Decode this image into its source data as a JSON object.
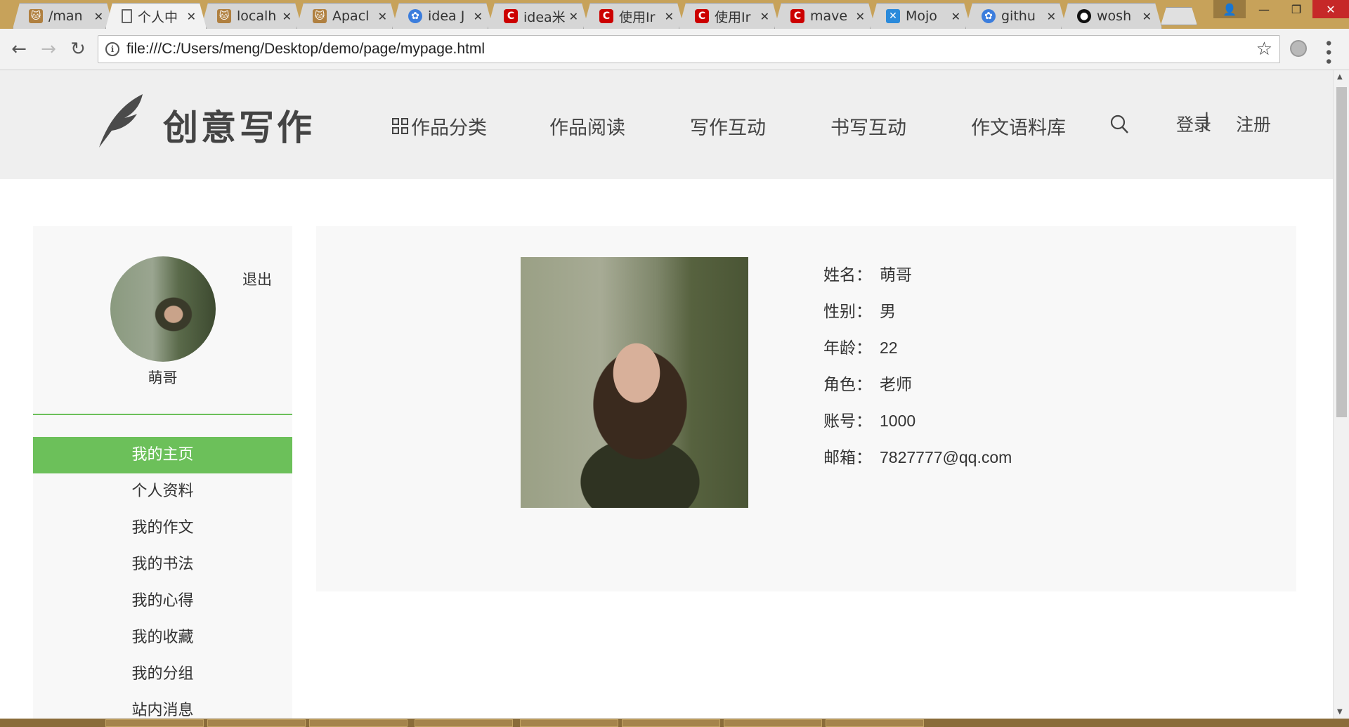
{
  "browser": {
    "tabs": [
      {
        "icon": "tomcat-icon",
        "title": "/man"
      },
      {
        "icon": "document-icon",
        "title": "个人中"
      },
      {
        "icon": "tomcat-icon",
        "title": "localh"
      },
      {
        "icon": "tomcat-icon",
        "title": "Apacl"
      },
      {
        "icon": "baidu-paw-icon",
        "title": "idea J"
      },
      {
        "icon": "csdn-icon",
        "title": "idea米"
      },
      {
        "icon": "csdn-icon",
        "title": "使用Ir"
      },
      {
        "icon": "csdn-icon",
        "title": "使用Ir"
      },
      {
        "icon": "csdn-icon",
        "title": "mave"
      },
      {
        "icon": "mojo-icon",
        "title": "Mojo"
      },
      {
        "icon": "baidu-paw-icon",
        "title": "githu"
      },
      {
        "icon": "github-icon",
        "title": "wosh"
      }
    ],
    "url": "file:///C:/Users/meng/Desktop/demo/page/mypage.html"
  },
  "site": {
    "logo_text": "创意写作",
    "nav": [
      "作品分类",
      "作品阅读",
      "写作互动",
      "书写互动",
      "作文语料库"
    ],
    "login": "登录",
    "separator": "|",
    "register": "注册"
  },
  "sidebar": {
    "logout": "退出",
    "username": "萌哥",
    "menu": [
      "我的主页",
      "个人资料",
      "我的作文",
      "我的书法",
      "我的心得",
      "我的收藏",
      "我的分组",
      "站内消息"
    ],
    "active_index": 0
  },
  "profile": {
    "rows": [
      {
        "key": "姓名：",
        "value": "萌哥"
      },
      {
        "key": "性别：",
        "value": "男"
      },
      {
        "key": "年龄：",
        "value": "22"
      },
      {
        "key": "角色：",
        "value": "老师"
      },
      {
        "key": "账号：",
        "value": "1000"
      },
      {
        "key": "邮箱：",
        "value": "7827777@qq.com"
      }
    ]
  },
  "colors": {
    "accent_green": "#6cc05a",
    "header_bg": "#efefef",
    "panel_bg": "#f8f8f8"
  }
}
